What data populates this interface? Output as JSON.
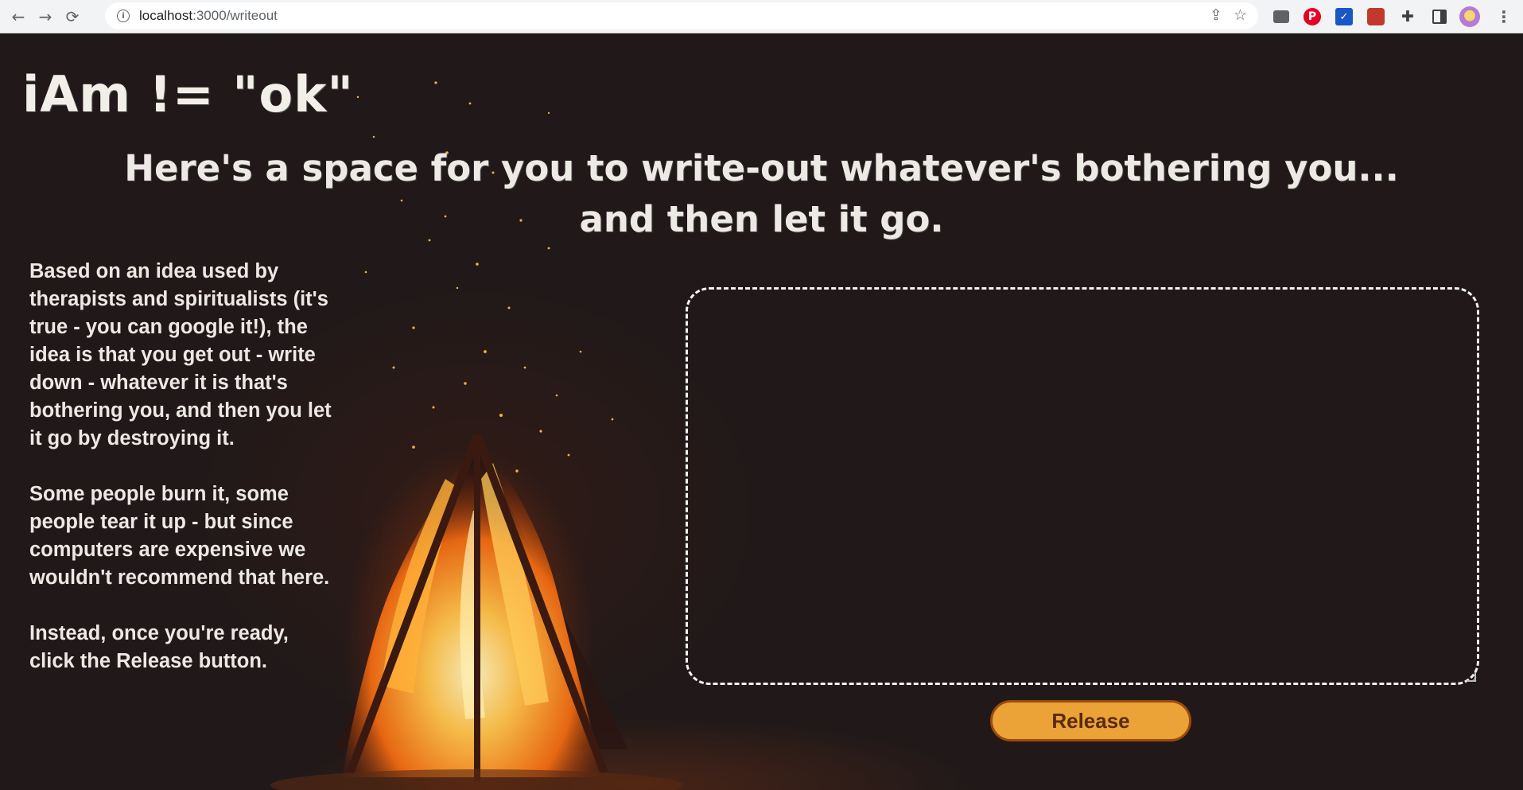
{
  "browser": {
    "url_host": "localhost",
    "url_path": ":3000/writeout",
    "back_icon": "arrow-left-icon",
    "forward_icon": "arrow-right-icon",
    "reload_icon": "reload-icon",
    "info_icon": "info-icon",
    "share_icon": "share-icon",
    "bookmark_icon": "star-icon"
  },
  "colors": {
    "background": "#211919",
    "accent": "#eba236",
    "accent_border": "#9c4a0d",
    "text": "#ece8e4"
  },
  "page": {
    "logo": "iAm != \"ok\"",
    "headline_line1": "Here's a space for you to write-out whatever's bothering you...",
    "headline_line2": "and then let it go.",
    "intro_paragraphs": [
      "Based on an idea used by therapists and spiritualists (it's true - you can google it!), the idea is that you get out - write down - whatever it is that's bothering you, and then you let it go by destroying it.",
      "Some people burn it, some people tear it up - but since computers are expensive we wouldn't recommend that here.",
      "Instead, once you're ready, click the Release button."
    ],
    "textarea_value": "",
    "release_label": "Release"
  }
}
